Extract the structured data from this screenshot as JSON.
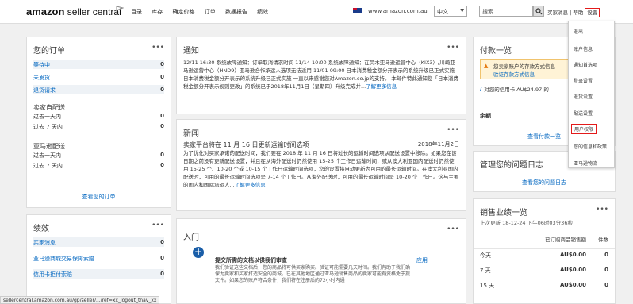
{
  "header": {
    "logo_main": "amazon",
    "logo_sub": " seller central",
    "nav": [
      "目录",
      "库存",
      "确定价格",
      "订单",
      "数据报告",
      "绩效"
    ],
    "domain": "www.amazon.com.au",
    "language": "中文",
    "search_placeholder": "搜索",
    "buyer_messages": "买家消息",
    "help": "帮助",
    "settings": "设置"
  },
  "orders": {
    "title": "您的订单",
    "rows": [
      {
        "label": "等待中",
        "value": "0"
      },
      {
        "label": "未发货",
        "value": "0"
      },
      {
        "label": "退货请求",
        "value": "0"
      }
    ],
    "sections": [
      {
        "heading": "卖家自配送",
        "rows": [
          {
            "label": "过去一天内",
            "value": "0"
          },
          {
            "label": "过去 7 天内",
            "value": "0"
          }
        ]
      },
      {
        "heading": "亚马逊配送",
        "rows": [
          {
            "label": "过去一天内",
            "value": "0"
          },
          {
            "label": "过去 7 天内",
            "value": "0"
          }
        ]
      }
    ],
    "view_link": "查看您的订单"
  },
  "performance": {
    "title": "绩效",
    "rows": [
      {
        "label": "买家消息",
        "value": "0"
      },
      {
        "label": "亚马逊商城交易保障索赔",
        "value": "0"
      },
      {
        "label": "信用卡拒付索赔",
        "value": "0"
      }
    ]
  },
  "notices": {
    "title": "通知",
    "text": "12/11 16:30 系统故障通知：订单取消请求时间 11/14 10:00 系统故障通知：在荧木亚马逊运营中心（KIX3）/川崎亚马逊运营中心（HND9）亚马逊合作承运人选项无法适用 11/01 09:00 日本消费税金额分开表示的系统升级已正式实施 日本消费税金额分开表示的系统升级已正式实施 一直以来感谢您对Amazon.co.jp的支持。 本邮件特此通知您「日本消费税金额分开表示规则更改」的系统已于2018年11月1日（星期四）升级完成并...",
    "more": "了解更多信息"
  },
  "news": {
    "title": "新闻",
    "headline": "卖家平台将在 11 月 16 日更新运输时间选项",
    "date": "2018年11月2日",
    "body": "为了优化对买家承诺的配送时间，我们要在 2018 年 11 月 16 日将过长的运输时间选项从配送设置中移除。如果您在该日期之前没有更新配送设置，并且在从海外配送时仍然使用 15-25 个工作日运输时间，或从澳大利亚国内配送时仍然使用 15-25 个、10-20 个或 10-15 个工作日运输时间选项，您的设置将自动更新为可用的最长运输时间。在澳大利亚国内配送时，可用的最长运输时间选项是 7-14 个工作日。从海外配送时，可用的最长运输时间是 10-20 个工作日。这与主要的国内和国际承运人...",
    "more": "了解更多信息"
  },
  "intro": {
    "title": "入门",
    "task_title": "提交所需的文档以供我们审查",
    "task_action": "应用",
    "task_body": "我们验证这些文档后，您的商品将可供买家购买。验证可能需要几天时间。我们有助于我们确保为卖家和买家打造安全的商城。已在其他地区通过亚马逊销售商品的卖家可能有资格免于提文件。如果您的账户符合条件，我们将在注册后的72小时内通"
  },
  "payments": {
    "title": "付款一览",
    "warn_1": "您卖家账户的存款方式信息",
    "warn_2": "验证存款方式信息",
    "info": "对您的信用卡 AU$24.97 的",
    "balance_label": "余额",
    "view_link": "查看付款一览"
  },
  "cases": {
    "title": "管理您的问题日志",
    "link": "查看您的问题日志"
  },
  "sales": {
    "title": "销售业绩一览",
    "updated": "上次更新 18-12-24 下午06时03分36秒",
    "col_sales": "已订购商品销售额",
    "col_units": "件数",
    "rows": [
      {
        "period": "今天",
        "sales": "AU$0.00",
        "units": "0"
      },
      {
        "period": "7 天",
        "sales": "AU$0.00",
        "units": "0"
      },
      {
        "period": "15 天",
        "sales": "AU$0.00",
        "units": "0"
      }
    ]
  },
  "settings_menu": {
    "items": [
      "退出",
      "账户信息",
      "通知首选项",
      "登录设置",
      "退货设置",
      "配送设置",
      "用户权限",
      "您的信息和政策",
      "亚马逊物流"
    ]
  },
  "status_url": "sellercentral.amazon.com.au/gp/seller/.../ref=xx_logout_tnav_xx",
  "colors": {
    "link": "#0066c0",
    "highlight": "#e31a1a",
    "task_icon": "#1a5ea8"
  },
  "icons": [
    "flag-icon",
    "search-icon",
    "warning-icon",
    "info-icon",
    "plus-circle-icon"
  ]
}
